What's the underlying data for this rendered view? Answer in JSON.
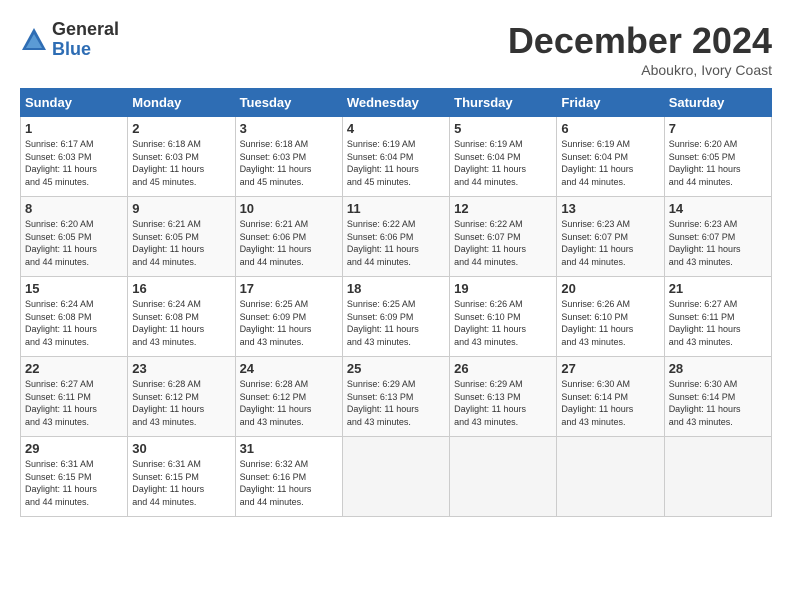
{
  "header": {
    "logo_general": "General",
    "logo_blue": "Blue",
    "month_title": "December 2024",
    "location": "Aboukro, Ivory Coast"
  },
  "days_of_week": [
    "Sunday",
    "Monday",
    "Tuesday",
    "Wednesday",
    "Thursday",
    "Friday",
    "Saturday"
  ],
  "weeks": [
    [
      {
        "num": "1",
        "info": "Sunrise: 6:17 AM\nSunset: 6:03 PM\nDaylight: 11 hours\nand 45 minutes."
      },
      {
        "num": "2",
        "info": "Sunrise: 6:18 AM\nSunset: 6:03 PM\nDaylight: 11 hours\nand 45 minutes."
      },
      {
        "num": "3",
        "info": "Sunrise: 6:18 AM\nSunset: 6:03 PM\nDaylight: 11 hours\nand 45 minutes."
      },
      {
        "num": "4",
        "info": "Sunrise: 6:19 AM\nSunset: 6:04 PM\nDaylight: 11 hours\nand 45 minutes."
      },
      {
        "num": "5",
        "info": "Sunrise: 6:19 AM\nSunset: 6:04 PM\nDaylight: 11 hours\nand 44 minutes."
      },
      {
        "num": "6",
        "info": "Sunrise: 6:19 AM\nSunset: 6:04 PM\nDaylight: 11 hours\nand 44 minutes."
      },
      {
        "num": "7",
        "info": "Sunrise: 6:20 AM\nSunset: 6:05 PM\nDaylight: 11 hours\nand 44 minutes."
      }
    ],
    [
      {
        "num": "8",
        "info": "Sunrise: 6:20 AM\nSunset: 6:05 PM\nDaylight: 11 hours\nand 44 minutes."
      },
      {
        "num": "9",
        "info": "Sunrise: 6:21 AM\nSunset: 6:05 PM\nDaylight: 11 hours\nand 44 minutes."
      },
      {
        "num": "10",
        "info": "Sunrise: 6:21 AM\nSunset: 6:06 PM\nDaylight: 11 hours\nand 44 minutes."
      },
      {
        "num": "11",
        "info": "Sunrise: 6:22 AM\nSunset: 6:06 PM\nDaylight: 11 hours\nand 44 minutes."
      },
      {
        "num": "12",
        "info": "Sunrise: 6:22 AM\nSunset: 6:07 PM\nDaylight: 11 hours\nand 44 minutes."
      },
      {
        "num": "13",
        "info": "Sunrise: 6:23 AM\nSunset: 6:07 PM\nDaylight: 11 hours\nand 44 minutes."
      },
      {
        "num": "14",
        "info": "Sunrise: 6:23 AM\nSunset: 6:07 PM\nDaylight: 11 hours\nand 43 minutes."
      }
    ],
    [
      {
        "num": "15",
        "info": "Sunrise: 6:24 AM\nSunset: 6:08 PM\nDaylight: 11 hours\nand 43 minutes."
      },
      {
        "num": "16",
        "info": "Sunrise: 6:24 AM\nSunset: 6:08 PM\nDaylight: 11 hours\nand 43 minutes."
      },
      {
        "num": "17",
        "info": "Sunrise: 6:25 AM\nSunset: 6:09 PM\nDaylight: 11 hours\nand 43 minutes."
      },
      {
        "num": "18",
        "info": "Sunrise: 6:25 AM\nSunset: 6:09 PM\nDaylight: 11 hours\nand 43 minutes."
      },
      {
        "num": "19",
        "info": "Sunrise: 6:26 AM\nSunset: 6:10 PM\nDaylight: 11 hours\nand 43 minutes."
      },
      {
        "num": "20",
        "info": "Sunrise: 6:26 AM\nSunset: 6:10 PM\nDaylight: 11 hours\nand 43 minutes."
      },
      {
        "num": "21",
        "info": "Sunrise: 6:27 AM\nSunset: 6:11 PM\nDaylight: 11 hours\nand 43 minutes."
      }
    ],
    [
      {
        "num": "22",
        "info": "Sunrise: 6:27 AM\nSunset: 6:11 PM\nDaylight: 11 hours\nand 43 minutes."
      },
      {
        "num": "23",
        "info": "Sunrise: 6:28 AM\nSunset: 6:12 PM\nDaylight: 11 hours\nand 43 minutes."
      },
      {
        "num": "24",
        "info": "Sunrise: 6:28 AM\nSunset: 6:12 PM\nDaylight: 11 hours\nand 43 minutes."
      },
      {
        "num": "25",
        "info": "Sunrise: 6:29 AM\nSunset: 6:13 PM\nDaylight: 11 hours\nand 43 minutes."
      },
      {
        "num": "26",
        "info": "Sunrise: 6:29 AM\nSunset: 6:13 PM\nDaylight: 11 hours\nand 43 minutes."
      },
      {
        "num": "27",
        "info": "Sunrise: 6:30 AM\nSunset: 6:14 PM\nDaylight: 11 hours\nand 43 minutes."
      },
      {
        "num": "28",
        "info": "Sunrise: 6:30 AM\nSunset: 6:14 PM\nDaylight: 11 hours\nand 43 minutes."
      }
    ],
    [
      {
        "num": "29",
        "info": "Sunrise: 6:31 AM\nSunset: 6:15 PM\nDaylight: 11 hours\nand 44 minutes."
      },
      {
        "num": "30",
        "info": "Sunrise: 6:31 AM\nSunset: 6:15 PM\nDaylight: 11 hours\nand 44 minutes."
      },
      {
        "num": "31",
        "info": "Sunrise: 6:32 AM\nSunset: 6:16 PM\nDaylight: 11 hours\nand 44 minutes."
      },
      null,
      null,
      null,
      null
    ]
  ]
}
